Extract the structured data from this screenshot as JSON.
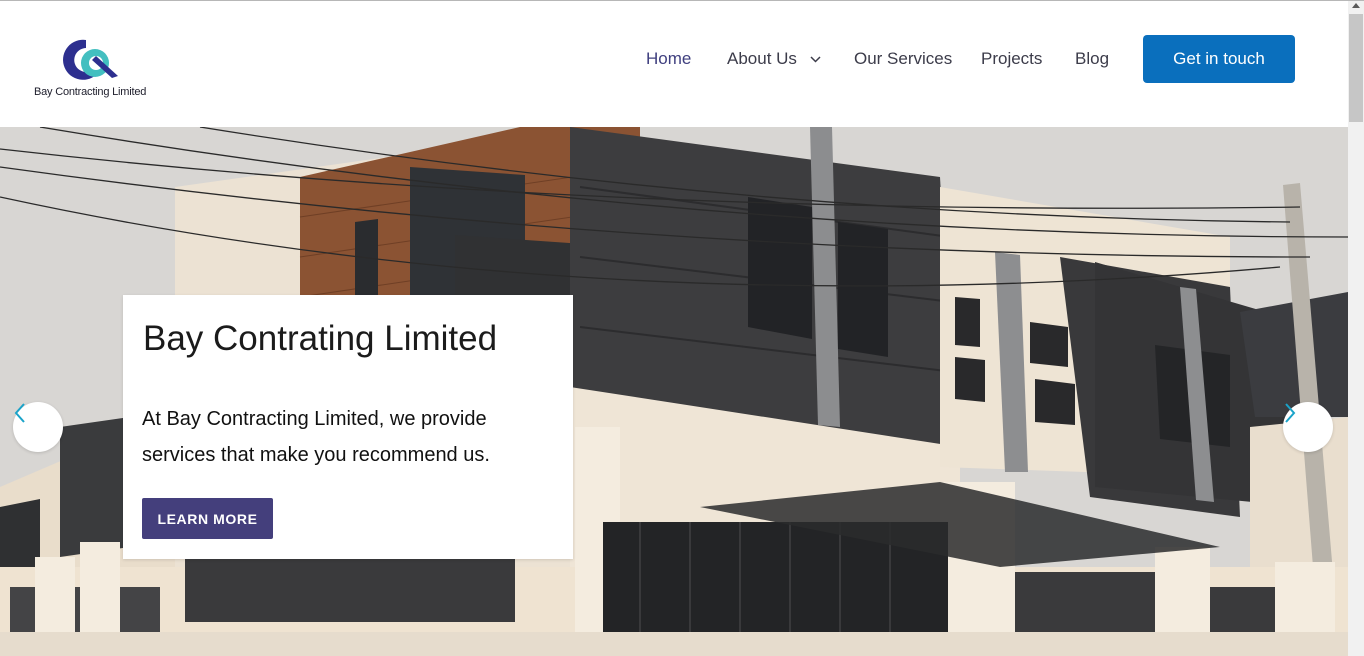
{
  "brand": {
    "name": "Bay Contracting Limited",
    "logo_icon": "bcl-logo-icon",
    "colors": {
      "navy": "#2d2f8f",
      "teal": "#43bfc0"
    }
  },
  "nav": {
    "items": [
      {
        "label": "Home",
        "active": true
      },
      {
        "label": "About Us",
        "has_dropdown": true
      },
      {
        "label": "Our Services"
      },
      {
        "label": "Projects"
      },
      {
        "label": "Blog"
      }
    ],
    "cta_label": "Get in touch"
  },
  "hero": {
    "title": "Bay Contrating Limited",
    "text": "At Bay Contracting Limited, we provide services that make you recommend us.",
    "button_label": "LEARN MORE",
    "prev_icon": "chevron-left-icon",
    "next_icon": "chevron-right-icon",
    "image": "house-photo"
  },
  "colors": {
    "cta": "#0a6fbd",
    "button": "#443f7c",
    "active_nav": "#3f3f7f",
    "arrow_icon": "#1aa3c9"
  }
}
